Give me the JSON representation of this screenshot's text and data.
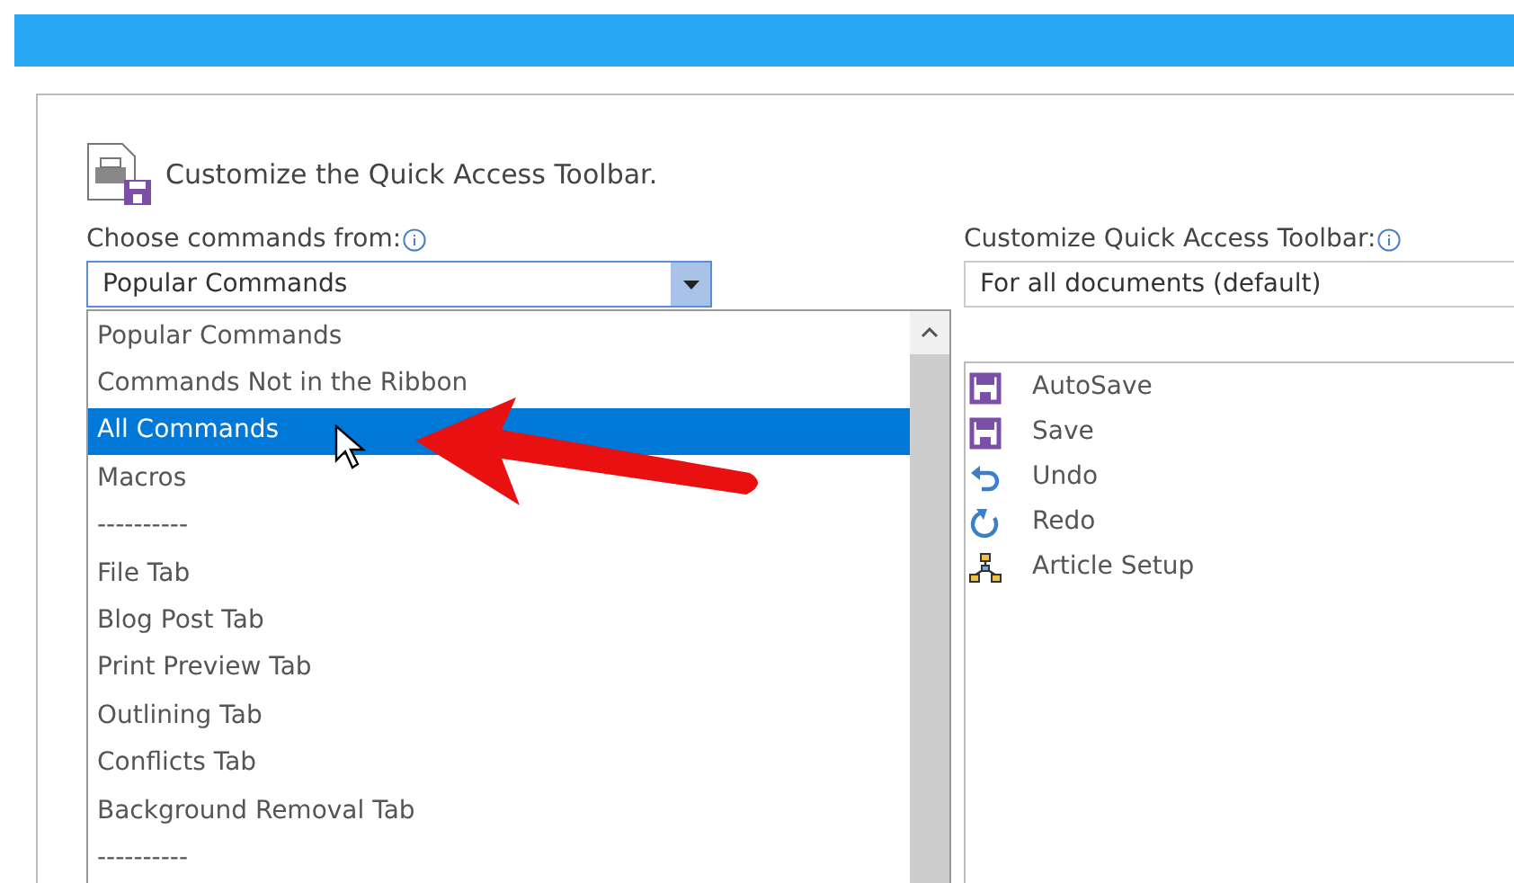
{
  "heading": "Customize the Quick Access Toolbar.",
  "left": {
    "label": "Choose commands from:",
    "dropdown": {
      "value": "Popular Commands"
    },
    "items": [
      {
        "label": "Popular Commands",
        "selected": false
      },
      {
        "label": "Commands Not in the Ribbon",
        "selected": false
      },
      {
        "label": "All Commands",
        "selected": true
      },
      {
        "label": "Macros",
        "selected": false
      },
      {
        "label": "----------",
        "selected": false
      },
      {
        "label": "File Tab",
        "selected": false
      },
      {
        "label": "Blog Post Tab",
        "selected": false
      },
      {
        "label": "Print Preview Tab",
        "selected": false
      },
      {
        "label": "Outlining Tab",
        "selected": false
      },
      {
        "label": "Conflicts Tab",
        "selected": false
      },
      {
        "label": "Background Removal Tab",
        "selected": false
      },
      {
        "label": "----------",
        "selected": false
      }
    ]
  },
  "right": {
    "label": "Customize Quick Access Toolbar:",
    "dropdown": {
      "value": "For all documents (default)"
    },
    "items": [
      {
        "label": "AutoSave",
        "kind": "save"
      },
      {
        "label": "Save",
        "kind": "save"
      },
      {
        "label": "Undo",
        "kind": "undo"
      },
      {
        "label": "Redo",
        "kind": "redo"
      },
      {
        "label": "Article Setup",
        "kind": "diagram"
      }
    ]
  }
}
